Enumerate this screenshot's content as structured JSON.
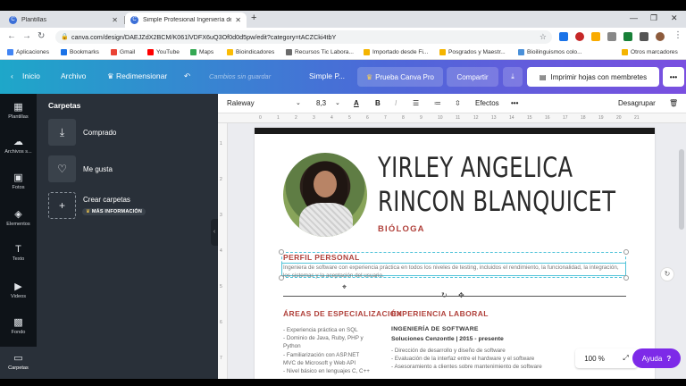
{
  "browser": {
    "tabs": [
      {
        "title": "Plantillas",
        "close": "✕"
      },
      {
        "title": "Simple Profesional Ingeniería de",
        "close": "✕"
      }
    ],
    "new_tab": "+",
    "url": "canva.com/design/DAEJZdX2BCM/K061lVDFX6uQ3Of0d0d5pw/edit?category=tACZCki4tbY",
    "bookmarks": [
      {
        "label": "Aplicaciones",
        "color": "#4285f4"
      },
      {
        "label": "Bookmarks",
        "color": "#1a73e8"
      },
      {
        "label": "Gmail",
        "color": "#ea4335"
      },
      {
        "label": "YouTube",
        "color": "#ff0000"
      },
      {
        "label": "Maps",
        "color": "#34a853"
      },
      {
        "label": "Bioindicadores",
        "color": "#fbbc05"
      },
      {
        "label": "Recursos Tic Labora...",
        "color": "#6b6b6b"
      },
      {
        "label": "Importado desde Fi...",
        "color": "#f4b400"
      },
      {
        "label": "Posgrados y Maestr...",
        "color": "#f4b400"
      },
      {
        "label": "Bioilinguismos colo...",
        "color": "#4a90d9"
      },
      {
        "label": "Otros marcadores",
        "color": "#f4b400"
      }
    ]
  },
  "canva_toolbar": {
    "home": "Inicio",
    "file": "Archivo",
    "resize": "Redimensionar",
    "unsaved": "Cambios sin guardar",
    "doc_title": "Simple P...",
    "pro": "Prueba Canva Pro",
    "share": "Compartir",
    "print": "Imprimir hojas con membretes",
    "more": "•••"
  },
  "rail": [
    {
      "label": "Plantillas",
      "icon": "▦"
    },
    {
      "label": "Archivos s...",
      "icon": "☁"
    },
    {
      "label": "Fotos",
      "icon": "▣"
    },
    {
      "label": "Elementos",
      "icon": "◈"
    },
    {
      "label": "Texto",
      "icon": "T"
    },
    {
      "label": "Videos",
      "icon": "▶"
    },
    {
      "label": "Fondo",
      "icon": "▩"
    },
    {
      "label": "Carpetas",
      "icon": "▭"
    }
  ],
  "panel": {
    "title": "Carpetas",
    "folders": [
      {
        "label": "Comprado",
        "icon": "⤓"
      },
      {
        "label": "Me gusta",
        "icon": "♡"
      },
      {
        "label": "Crear carpetas",
        "icon": "+"
      }
    ],
    "more_info": "MÁS INFORMACIÓN"
  },
  "format_bar": {
    "font": "Raleway",
    "size": "8,3",
    "effects": "Efectos",
    "more": "•••",
    "ungroup": "Desagrupar"
  },
  "resume": {
    "name_line1": "YIRLEY ANGELICA",
    "name_line2": "RINCON BLANQUICET",
    "role": "BIÓLOGA",
    "perfil_head": "PERFIL PERSONAL",
    "perfil_text": "Ingeniera de software con experiencia práctica en todos los niveles de testing, incluidos el rendimiento, la funcionalidad, la integración, los sistemas y la aceptación del usuario.",
    "areas_head": "ÁREAS DE ESPECIALIZACIÓN",
    "areas": [
      "- Experiencia práctica en SQL",
      "- Dominio de Java, Ruby, PHP y",
      "Python",
      "- Familiarización con ASP.NET",
      "MVC de Microsoft y Web API",
      "- Nivel básico en lenguajes C, C++"
    ],
    "exp_head": "EXPERIENCIA LABORAL",
    "job_title": "INGENIERÍA DE SOFTWARE",
    "job_company": "Soluciones Cenzontle | 2015 - presente",
    "job_items": [
      "- Dirección de desarrollo y diseño de software",
      "- Evaluación de la interfaz entre el hardware y el software",
      "- Asesoramiento a clientes sobre mantenimiento de software"
    ]
  },
  "zoom": "100 %",
  "help": "Ayuda",
  "help_icon": "?"
}
